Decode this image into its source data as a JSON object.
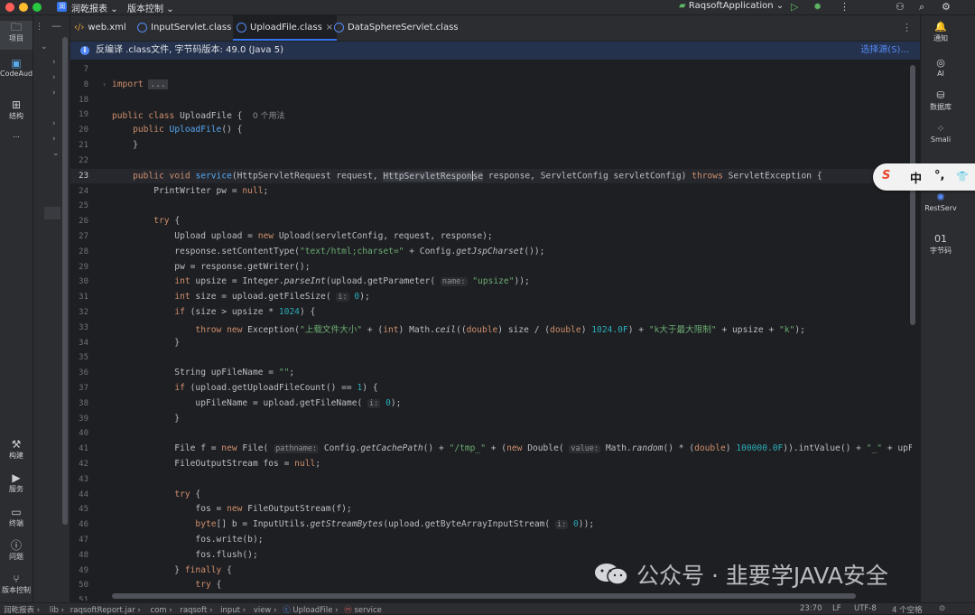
{
  "titlebar": {
    "project_badge": "润",
    "project_name": "润乾报表",
    "vcs": "版本控制",
    "run_config": "RaqsoftApplication"
  },
  "left_toolbar": {
    "top": [
      {
        "label": "项目",
        "icon": "folder-icon"
      },
      {
        "label": "CodeAud",
        "icon": "codeaudit-icon"
      },
      {
        "label": "结构",
        "icon": "structure-icon"
      },
      {
        "label": "...",
        "icon": "more-icon"
      }
    ],
    "bottom": [
      {
        "label": "构建",
        "icon": "hammer-icon"
      },
      {
        "label": "服务",
        "icon": "services-icon"
      },
      {
        "label": "终端",
        "icon": "terminal-icon"
      },
      {
        "label": "问题",
        "icon": "problems-icon"
      },
      {
        "label": "版本控制",
        "icon": "git-icon"
      }
    ]
  },
  "tabs": [
    {
      "label": "web.xml"
    },
    {
      "label": "InputServlet.class"
    },
    {
      "label": "UploadFile.class",
      "close": "×"
    },
    {
      "label": "DataSphereServlet.class"
    }
  ],
  "banner": {
    "info_icon": "i",
    "text": "反编译 .class文件, 字节码版本: 49.0 (Java 5)",
    "action": "选择源(S)..."
  },
  "editor": {
    "line_numbers": [
      "7",
      "8",
      "18",
      "19",
      "20",
      "21",
      "22",
      "23",
      "24",
      "25",
      "26",
      "27",
      "28",
      "29",
      "30",
      "31",
      "32",
      "33",
      "34",
      "35",
      "36",
      "37",
      "38",
      "39",
      "40",
      "41",
      "42",
      "43",
      "44",
      "45",
      "46",
      "47",
      "48",
      "49",
      "50",
      "51"
    ],
    "import_kw": "import",
    "import_fold": "...",
    "usages": "0 个用法",
    "hints": {
      "name": "name:",
      "i": "i:",
      "pathname": "pathname:",
      "value": "value:"
    }
  },
  "right_toolbar": [
    {
      "label": "通知",
      "icon": "bell-icon"
    },
    {
      "label": "AI",
      "icon": "ai-icon"
    },
    {
      "label": "数据库",
      "icon": "database-icon"
    },
    {
      "label": "Smali",
      "icon": "smali-icon"
    },
    {
      "label": "RestServ",
      "icon": "rest-icon"
    },
    {
      "label": "字节码",
      "icon": "bytecode-icon",
      "glyph": "01"
    }
  ],
  "ime": {
    "s": "S",
    "zh": "中",
    "punct": "°,",
    "shirt": "👕"
  },
  "statusbar": {
    "breadcrumb": [
      "润乾报表",
      "lib",
      "raqsoftReport.jar",
      "com",
      "raqsoft",
      "input",
      "view",
      "UploadFile",
      "service"
    ],
    "position": "23:70",
    "line_sep": "LF",
    "encoding": "UTF-8",
    "indent": "4 个空格"
  },
  "watermark": {
    "text": "公众号 · 韭要学JAVA安全"
  }
}
